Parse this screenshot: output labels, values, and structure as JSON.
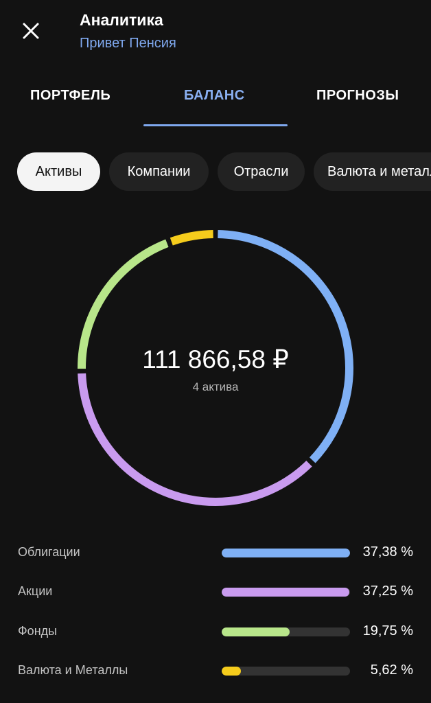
{
  "header": {
    "title": "Аналитика",
    "subtitle": "Привет Пенсия",
    "close_icon": "close-icon"
  },
  "tabs": [
    {
      "label": "ПОРТФЕЛЬ",
      "active": false
    },
    {
      "label": "БАЛАНС",
      "active": true
    },
    {
      "label": "ПРОГНОЗЫ",
      "active": false
    }
  ],
  "chips": [
    {
      "label": "Активы",
      "active": true
    },
    {
      "label": "Компании",
      "active": false
    },
    {
      "label": "Отрасли",
      "active": false
    },
    {
      "label": "Валюта и металлы",
      "active": false
    }
  ],
  "summary": {
    "total": "111 866,58 ₽",
    "count": "4 актива"
  },
  "chart_data": {
    "type": "pie",
    "categories": [
      "Облигации",
      "Акции",
      "Фонды",
      "Валюта и Металлы"
    ],
    "values": [
      37.38,
      37.25,
      19.75,
      5.62
    ],
    "labels": [
      "37,38 %",
      "37,25 %",
      "19,75 %",
      "5,62 %"
    ],
    "colors": [
      "#7fb0f5",
      "#c99bef",
      "#b8e68a",
      "#f5cc1c"
    ]
  },
  "colors": {
    "background": "#121212",
    "accent": "#7fa8ee",
    "track": "#333333"
  }
}
